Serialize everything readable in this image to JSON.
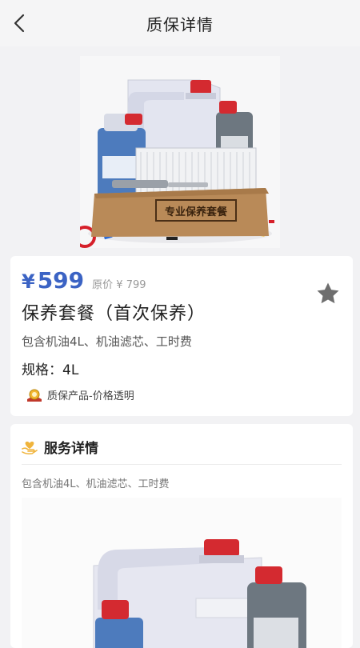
{
  "header": {
    "title": "质保详情",
    "back_icon": "chevron-left-icon"
  },
  "product": {
    "price_symbol": "¥",
    "price": "599",
    "original_price": "原价 ¥ 799",
    "title": "保养套餐（首次保养）",
    "description": "包含机油4L、机油滤芯、工时费",
    "spec_label": "规格",
    "spec_value": "4L",
    "badge_text": "质保产品-价格透明",
    "box_label": "专业保养套餐",
    "favorite_icon": "star-icon"
  },
  "service": {
    "title": "服务详情",
    "description": "包含机油4L、机油滤芯、工时费"
  },
  "colors": {
    "accent": "#3b63c4",
    "star": "#6e6e6e",
    "service_icon": "#f0b43c"
  }
}
